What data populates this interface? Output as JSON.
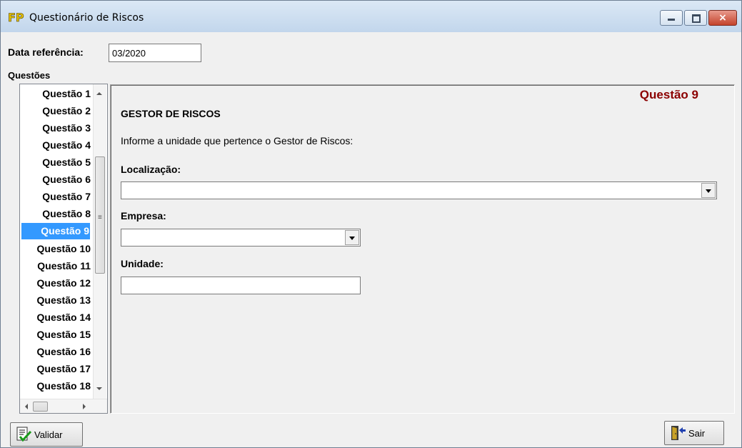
{
  "window": {
    "title": "Questionário de Riscos",
    "controls": {
      "minimize": "minimize",
      "maximize": "maximize",
      "close": "×"
    }
  },
  "reference": {
    "label": "Data referência:",
    "value": "03/2020"
  },
  "questions": {
    "label": "Questões",
    "items": [
      "Questão 1",
      "Questão 2",
      "Questão 3",
      "Questão 4",
      "Questão 5",
      "Questão 6",
      "Questão 7",
      "Questão 8",
      "Questão 9",
      "Questão 10",
      "Questão 11",
      "Questão 12",
      "Questão 13",
      "Questão 14",
      "Questão 15",
      "Questão 16",
      "Questão 17",
      "Questão 18"
    ],
    "selected_index": 8
  },
  "panel": {
    "question_number": "Questão 9",
    "section_title": "GESTOR DE RISCOS",
    "instruction": "Informe a unidade que pertence o Gestor de Riscos:",
    "fields": {
      "localizacao": {
        "label": "Localização:",
        "value": ""
      },
      "empresa": {
        "label": "Empresa:",
        "value": ""
      },
      "unidade": {
        "label": "Unidade:",
        "value": ""
      }
    }
  },
  "buttons": {
    "validar": {
      "label": "Validar",
      "icon": "validate-checklist-icon"
    },
    "sair": {
      "label": "Sair",
      "icon": "exit-door-icon"
    }
  },
  "colors": {
    "selection": "#3399ff",
    "question_number": "#8b0000",
    "title_bar": "#c8daee"
  }
}
